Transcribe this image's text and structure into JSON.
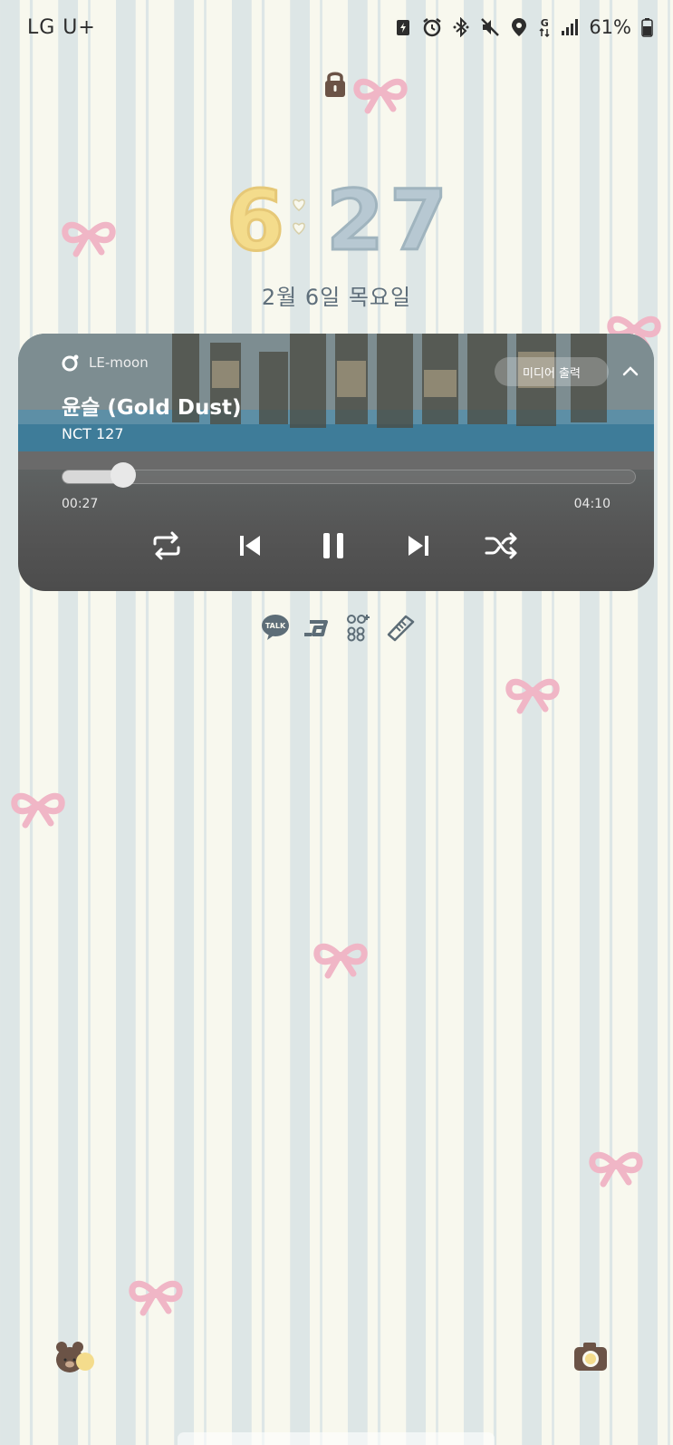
{
  "status_bar": {
    "carrier": "LG U+",
    "network": "G",
    "battery_percent": "61%",
    "icons": [
      "battery-saver-icon",
      "alarm-icon",
      "bluetooth-icon",
      "mute-icon",
      "location-icon",
      "mobile-data-icon",
      "signal-icon",
      "battery-icon"
    ]
  },
  "lockscreen": {
    "clock_hour": "6",
    "clock_minute": "27",
    "date": "2월 6일 목요일"
  },
  "media_player": {
    "source_app": "LE-moon",
    "output_label": "미디어 출력",
    "title": "윤슬 (Gold Dust)",
    "artist": "NCT 127",
    "current_time": "00:27",
    "total_time": "04:10",
    "progress": 0.108
  },
  "notification_icons": [
    "kakaotalk-icon",
    "app-b-icon",
    "quote-icon",
    "sneaker-icon"
  ],
  "notification_labels": {
    "kakaotalk": "TALK"
  },
  "shortcuts": {
    "left": "bear-icon",
    "right": "camera-icon"
  },
  "colors": {
    "bow": "#f0b6c6",
    "stripe_blue": "#dde6e6",
    "stripe_cream": "#f8f8ee"
  }
}
